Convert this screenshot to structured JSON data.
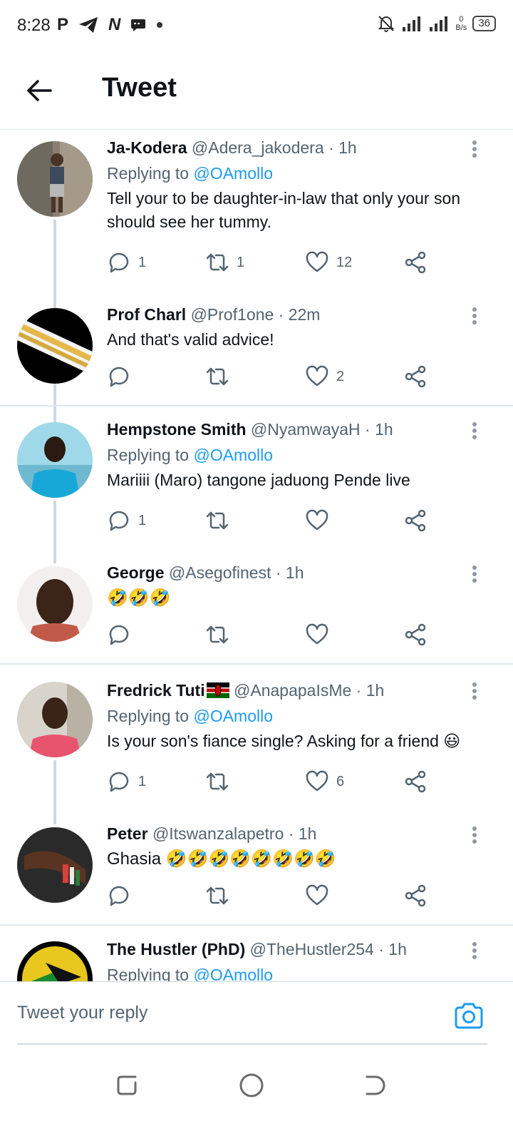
{
  "status_bar": {
    "time": "8:28",
    "left_glyphs": [
      "P",
      "N"
    ],
    "net_speed_value": "0",
    "net_speed_unit": "B/s",
    "battery": "36"
  },
  "header": {
    "title": "Tweet"
  },
  "tweets": [
    {
      "author": "Ja-Kodera",
      "handle": "@Adera_jakodera",
      "time": "· 1h",
      "replying_label": "Replying to",
      "replying_to": "@OAmollo",
      "text": "Tell your to be daughter-in-law that only your son should see her tummy.",
      "replies": "1",
      "retweets": "1",
      "likes": "12"
    },
    {
      "author": "Prof Charl",
      "handle": "@Prof1one",
      "time": "· 22m",
      "text": "And that's valid advice!",
      "replies": "",
      "retweets": "",
      "likes": "2"
    },
    {
      "author": "Hempstone Smith",
      "handle": "@NyamwayaH",
      "time": "· 1h",
      "replying_label": "Replying to",
      "replying_to": "@OAmollo",
      "text": "Mariiii (Maro) tangone jaduong Pende live",
      "replies": "1",
      "retweets": "",
      "likes": ""
    },
    {
      "author": "George",
      "handle": "@Asegofinest",
      "time": "· 1h",
      "text": "🤣🤣🤣",
      "replies": "",
      "retweets": "",
      "likes": ""
    },
    {
      "author": "Fredrick Tuti",
      "handle": "@AnapapaIsMe",
      "time": "· 1h",
      "replying_label": "Replying to",
      "replying_to": "@OAmollo",
      "text": "Is your son's fiance single? Asking for a friend 😃",
      "replies": "1",
      "retweets": "",
      "likes": "6"
    },
    {
      "author": "Peter",
      "handle": "@Itswanzalapetro",
      "time": "· 1h",
      "text": "Ghasia 🤣🤣🤣🤣🤣🤣🤣🤣",
      "replies": "",
      "retweets": "",
      "likes": ""
    },
    {
      "author": "The Hustler (PhD)",
      "handle": "@TheHustler254",
      "time": "· 1h",
      "replying_label": "Replying to",
      "replying_to": "@OAmollo"
    }
  ],
  "reply_bar": {
    "placeholder": "Tweet your reply"
  },
  "icons": {
    "back": "arrow-left-icon",
    "more": "more-vertical-icon",
    "reply": "comment-icon",
    "retweet": "retweet-icon",
    "like": "heart-icon",
    "share": "share-icon",
    "camera": "camera-icon",
    "accent": "#1d9bf0"
  }
}
